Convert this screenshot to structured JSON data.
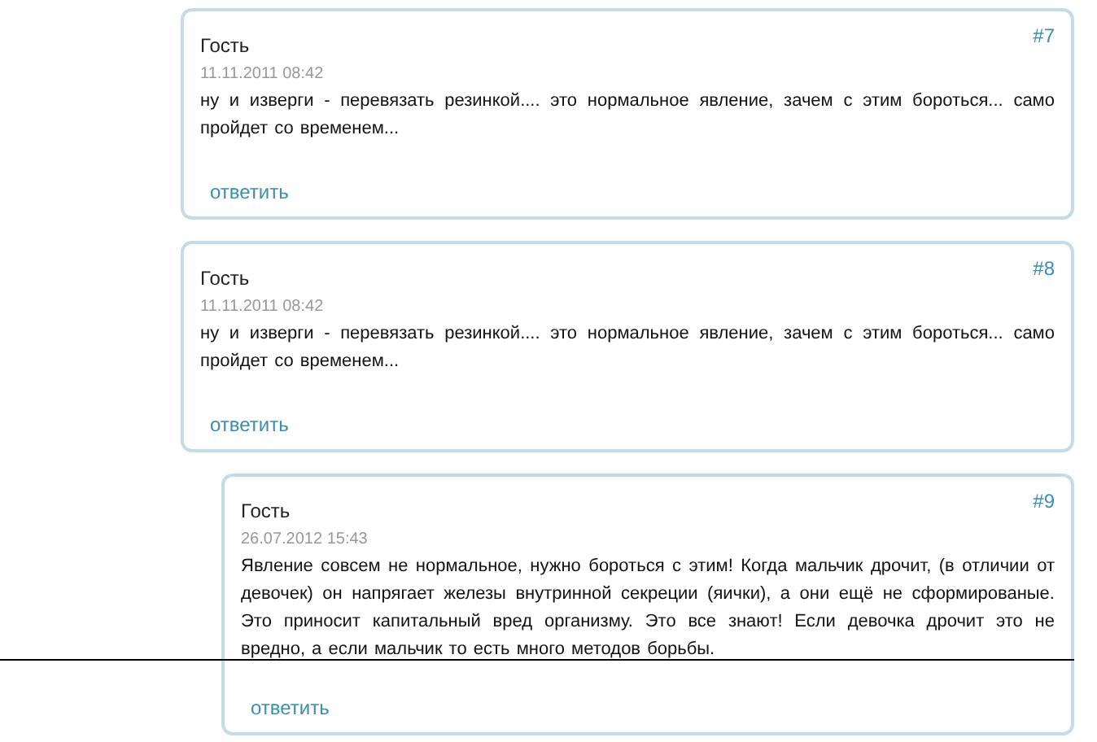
{
  "comments": [
    {
      "author": "Гость",
      "date": "11.11.2011 08:42",
      "number": "#7",
      "text": "ну и изверги - перевязать резинкой.... это нормальное явление, зачем с этим бороться... само пройдет со временем...",
      "reply": "ответить"
    },
    {
      "author": "Гость",
      "date": "11.11.2011 08:42",
      "number": "#8",
      "text": "ну и изверги - перевязать резинкой.... это нормальное явление, зачем с этим бороться... само пройдет со временем...",
      "reply": "ответить",
      "children": [
        {
          "author": "Гость",
          "date": "26.07.2012 15:43",
          "number": "#9",
          "text": "Явление совсем не нормальное, нужно бороться с этим! Когда мальчик дрочит, (в отличии от девочек) он напрягает железы внутринной секреции (яички), а они ещё не сформированые. Это приносит капитальный вред организму. Это все знают! Если девочка дрочит это не вредно, а если мальчик то есть много методов борьбы.",
          "reply": "ответить"
        }
      ]
    }
  ]
}
